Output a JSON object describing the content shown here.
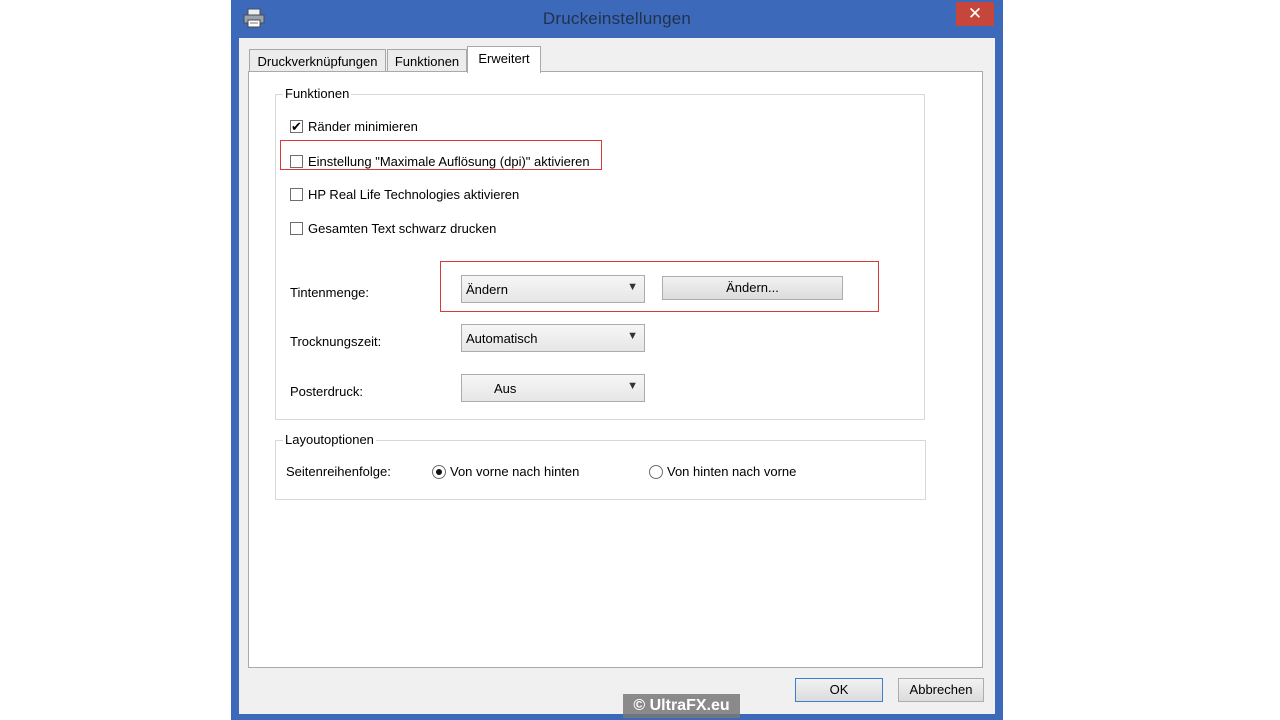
{
  "window": {
    "title": "Druckeinstellungen",
    "close_label": "✕",
    "accent_color": "#3c69ba",
    "close_color": "#c7463c"
  },
  "tabs": [
    {
      "label": "Druckverknüpfungen",
      "active": false
    },
    {
      "label": "Funktionen",
      "active": false
    },
    {
      "label": "Erweitert",
      "active": true
    }
  ],
  "funktionen_group": {
    "title": "Funktionen",
    "checkboxes": [
      {
        "label": "Ränder minimieren",
        "checked": true
      },
      {
        "label": "Einstellung \"Maximale Auflösung (dpi)\" aktivieren",
        "checked": false,
        "highlighted": true
      },
      {
        "label": "HP Real Life Technologies aktivieren",
        "checked": false
      },
      {
        "label": "Gesamten Text schwarz drucken",
        "checked": false
      }
    ],
    "tintenmenge": {
      "label": "Tintenmenge:",
      "select_value": "Ändern",
      "button_label": "Ändern...",
      "highlighted": true
    },
    "trocknungszeit": {
      "label": "Trocknungszeit:",
      "select_value": "Automatisch"
    },
    "posterdruck": {
      "label": "Posterdruck:",
      "select_value": "Aus"
    }
  },
  "layout_group": {
    "title": "Layoutoptionen",
    "seitenreihenfolge_label": "Seitenreihenfolge:",
    "options": [
      {
        "label": "Von vorne nach hinten",
        "selected": true
      },
      {
        "label": "Von hinten nach vorne",
        "selected": false
      }
    ]
  },
  "footer": {
    "ok_label": "OK",
    "cancel_label": "Abbrechen"
  },
  "watermark": "© UltraFX.eu",
  "icons": {
    "app": "printer-icon",
    "check": "✔",
    "caret": "⌄"
  },
  "highlight_color": "#d83a3a"
}
